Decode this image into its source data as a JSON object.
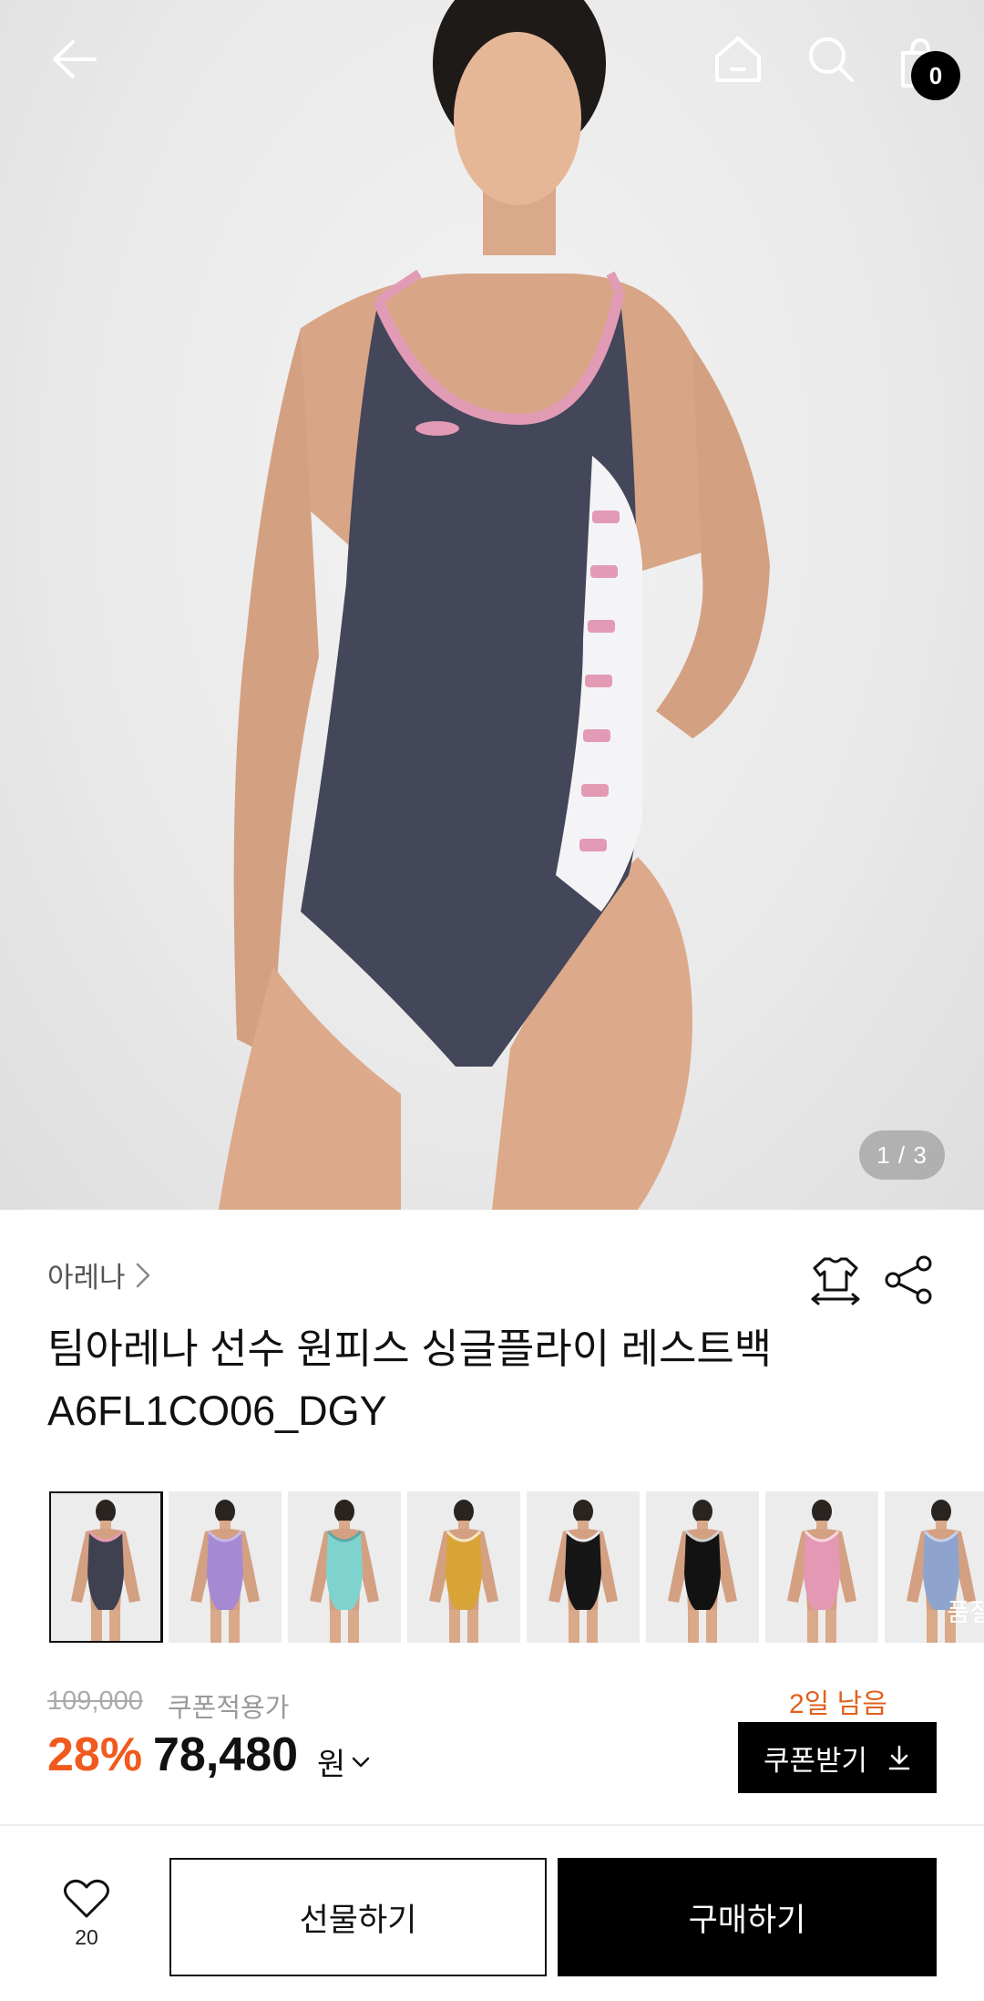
{
  "header": {
    "icons": [
      "back-arrow-icon",
      "home-icon",
      "search-icon",
      "shopping-bag-icon"
    ],
    "cart_count": "0"
  },
  "gallery": {
    "counter": "1 / 3"
  },
  "product": {
    "brand": "아레나",
    "title_line1": "팀아레나 선수 원피스 싱글플라이 레스트백",
    "title_line2": "A6FL1CO06_DGY",
    "icons": [
      "size-guide-icon",
      "share-icon"
    ]
  },
  "swatches": [
    {
      "color": "#3f4150",
      "accent": "#e39ab4",
      "selected": true
    },
    {
      "color": "#a58ad3",
      "accent": "#c9b8e8",
      "selected": false
    },
    {
      "color": "#7fd3cf",
      "accent": "#5aa9a6",
      "selected": false
    },
    {
      "color": "#d9a437",
      "accent": "#f4e7c2",
      "selected": false
    },
    {
      "color": "#161616",
      "accent": "#eaeaea",
      "selected": false
    },
    {
      "color": "#121212",
      "accent": "#cfcfcf",
      "selected": false
    },
    {
      "color": "#e398b3",
      "accent": "#f5d8e2",
      "selected": false
    },
    {
      "color": "#8ea4cf",
      "accent": "#c5d2ea",
      "selected": false,
      "label": "품절"
    }
  ],
  "pricing": {
    "original": "109,000",
    "coupon_label": "쿠폰적용가",
    "discount": "28%",
    "price": "78,480",
    "currency": "원",
    "days_left": "2일 남음",
    "coupon_button": "쿠폰받기"
  },
  "bottom": {
    "wish_count": "20",
    "gift_button": "선물하기",
    "buy_button": "구매하기"
  },
  "colors": {
    "accent_orange": "#f05a1e",
    "black": "#000000"
  }
}
